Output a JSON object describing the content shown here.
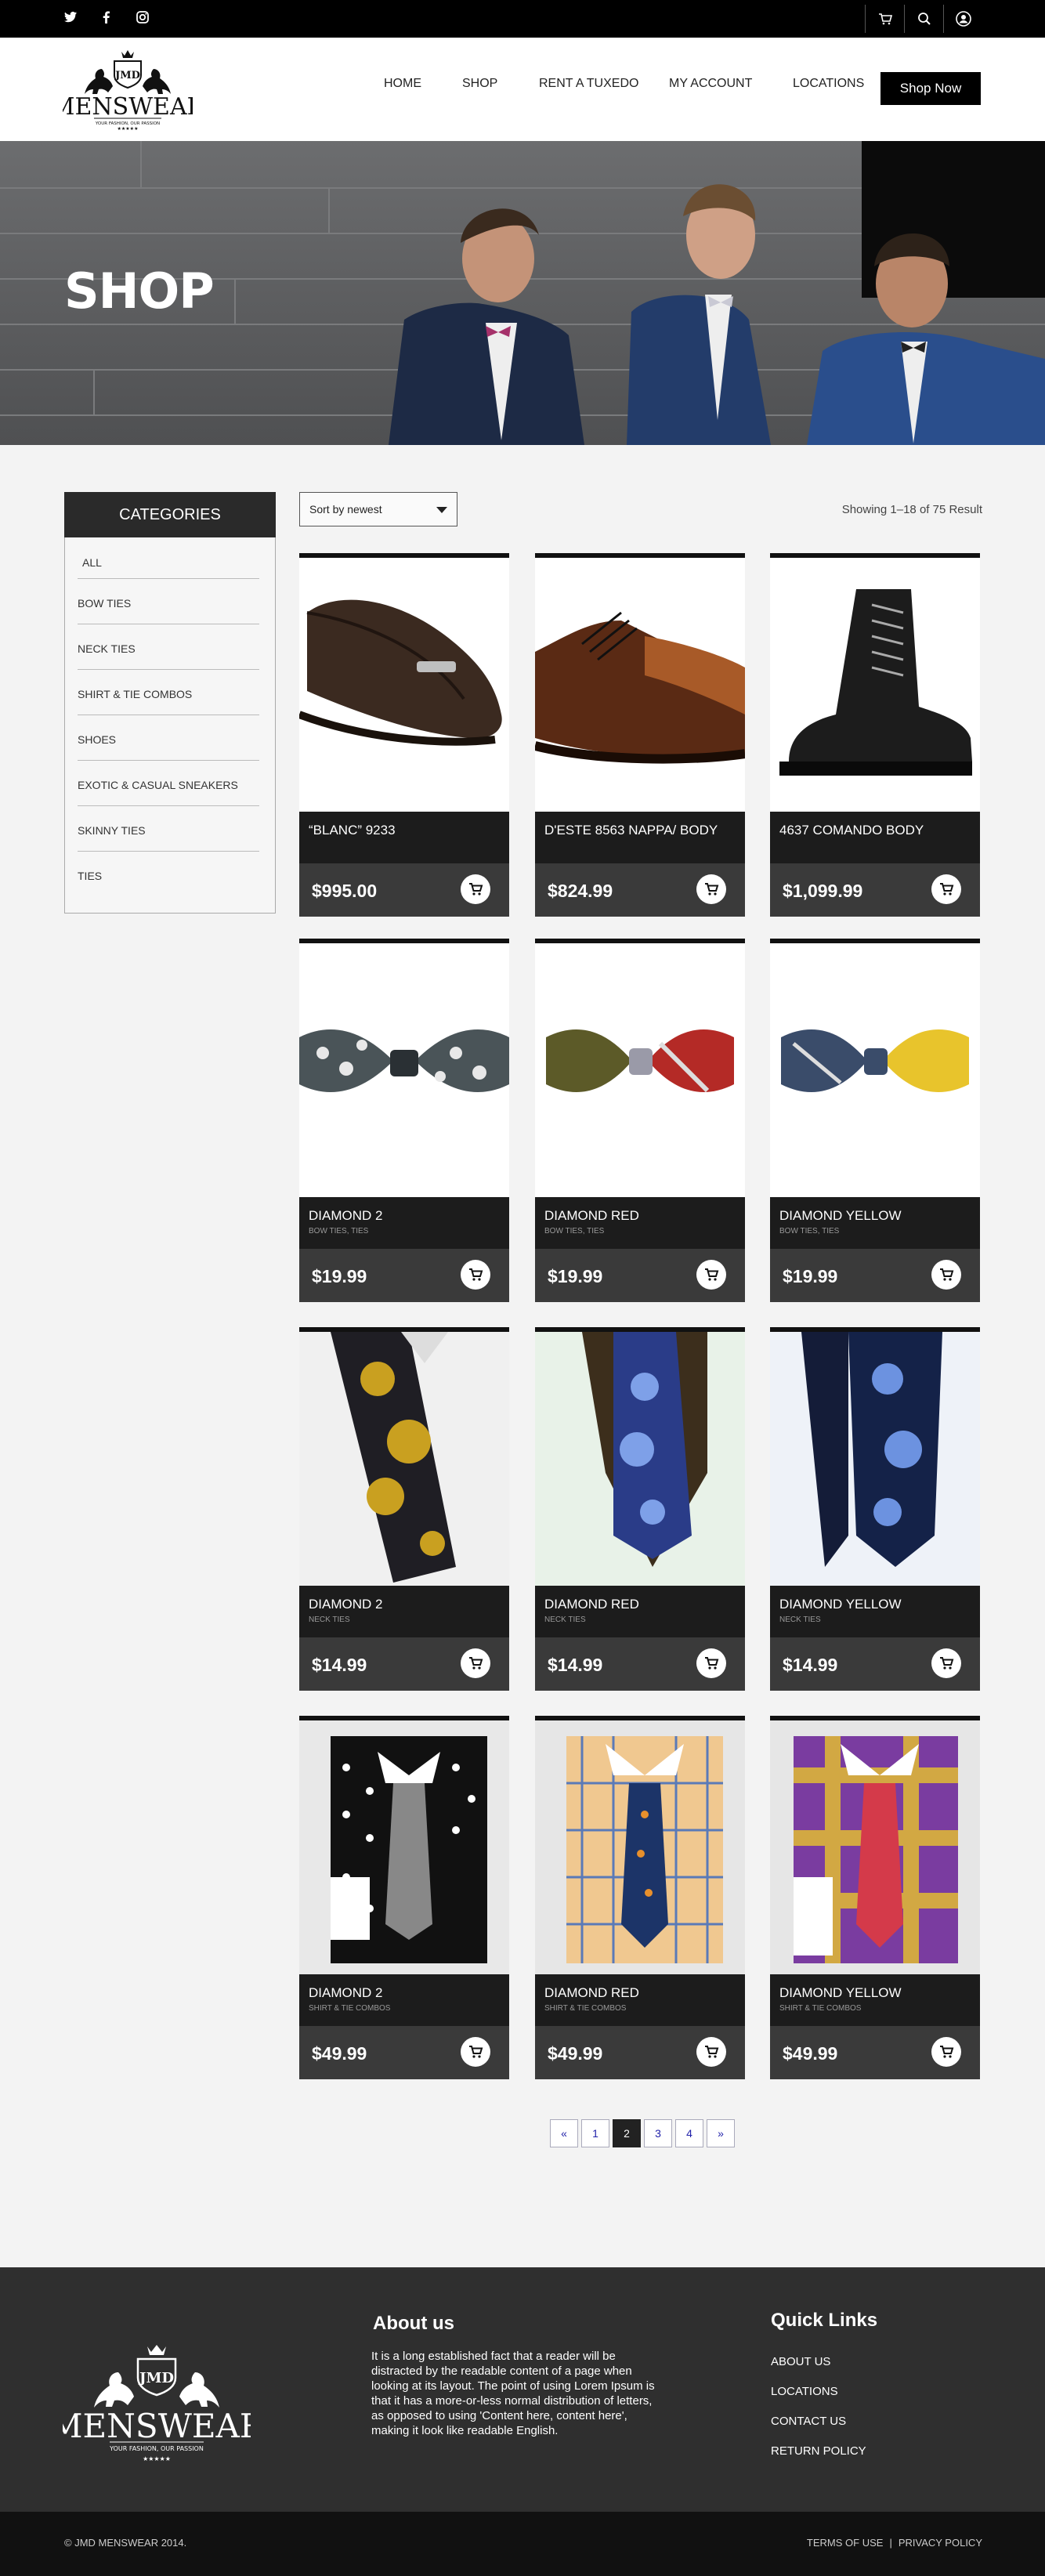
{
  "topbar": {
    "social": [
      "twitter-icon",
      "facebook-icon",
      "instagram-icon"
    ],
    "right_icons": [
      "cart-icon",
      "search-icon",
      "user-icon"
    ]
  },
  "header": {
    "logo": {
      "monogram": "JMD",
      "name": "MENSWEAR",
      "tagline": "YOUR FASHION, OUR PASSION"
    },
    "nav": [
      "HOME",
      "SHOP",
      "RENT A TUXEDO",
      "MY ACCOUNT",
      "LOCATIONS"
    ],
    "cta": "Shop Now"
  },
  "hero": {
    "title": "SHOP"
  },
  "sidebar": {
    "heading": "CATEGORIES",
    "items": [
      "ALL",
      "BOW TIES",
      "NECK TIES",
      "SHIRT & TIE COMBOS",
      "SHOES",
      "EXOTIC & CASUAL SNEAKERS",
      "SKINNY TIES",
      "TIES"
    ]
  },
  "toolbar": {
    "sort_value": "Sort by newest",
    "result_text": "Showing  1–18 of  75  Result"
  },
  "products": [
    {
      "title": "“BLANC” 9233",
      "category": "",
      "price": "$995.00",
      "image": "loafer"
    },
    {
      "title": "D'ESTE 8563 NAPPA/ BODY",
      "category": "",
      "price": "$824.99",
      "image": "oxford"
    },
    {
      "title": "4637 COMANDO BODY",
      "category": "",
      "price": "$1,099.99",
      "image": "boot"
    },
    {
      "title": "DIAMOND 2",
      "category": "BOW TIES, TIES",
      "price": "$19.99",
      "image": "bowtie-gray"
    },
    {
      "title": "DIAMOND RED",
      "category": "BOW TIES, TIES",
      "price": "$19.99",
      "image": "bowtie-red"
    },
    {
      "title": "DIAMOND YELLOW",
      "category": "BOW TIES, TIES",
      "price": "$19.99",
      "image": "bowtie-yellow"
    },
    {
      "title": "DIAMOND 2",
      "category": "NECK TIES",
      "price": "$14.99",
      "image": "tie-gold"
    },
    {
      "title": "DIAMOND RED",
      "category": "NECK TIES",
      "price": "$14.99",
      "image": "tie-blue-brown"
    },
    {
      "title": "DIAMOND YELLOW",
      "category": "NECK TIES",
      "price": "$14.99",
      "image": "tie-navy"
    },
    {
      "title": "DIAMOND 2",
      "category": "SHIRT & TIE COMBOS",
      "price": "$49.99",
      "image": "shirt-polka"
    },
    {
      "title": "DIAMOND RED",
      "category": "SHIRT & TIE COMBOS",
      "price": "$49.99",
      "image": "shirt-plaid-orange"
    },
    {
      "title": "DIAMOND YELLOW",
      "category": "SHIRT & TIE COMBOS",
      "price": "$49.99",
      "image": "shirt-plaid-purple"
    }
  ],
  "pagination": [
    "«",
    "1",
    "2",
    "3",
    "4",
    "»"
  ],
  "pagination_active": "2",
  "footer": {
    "about_heading": "About us",
    "about_text": "It is a long established fact that a reader will be distracted by the readable content of a page when looking at its layout. The point of using Lorem Ipsum is that it has a more-or-less normal distribution of letters, as opposed to using 'Content here, content here', making it look like readable English.",
    "quick_links_heading": "Quick Links",
    "quick_links": [
      "ABOUT US",
      "LOCATIONS",
      "CONTACT US",
      "RETURN POLICY"
    ],
    "logo_tagline": "YOUR FASHION, OUR PASSION",
    "copyright": "© JMD MENSWEAR 2014.",
    "bottom_links": [
      "TERMS OF USE",
      "PRIVACY POLICY"
    ]
  },
  "colors": {
    "dark": "#1c1c1c",
    "price_band": "#3a3a3a",
    "accent": "#000000",
    "page_bg": "#f3f3f3"
  }
}
